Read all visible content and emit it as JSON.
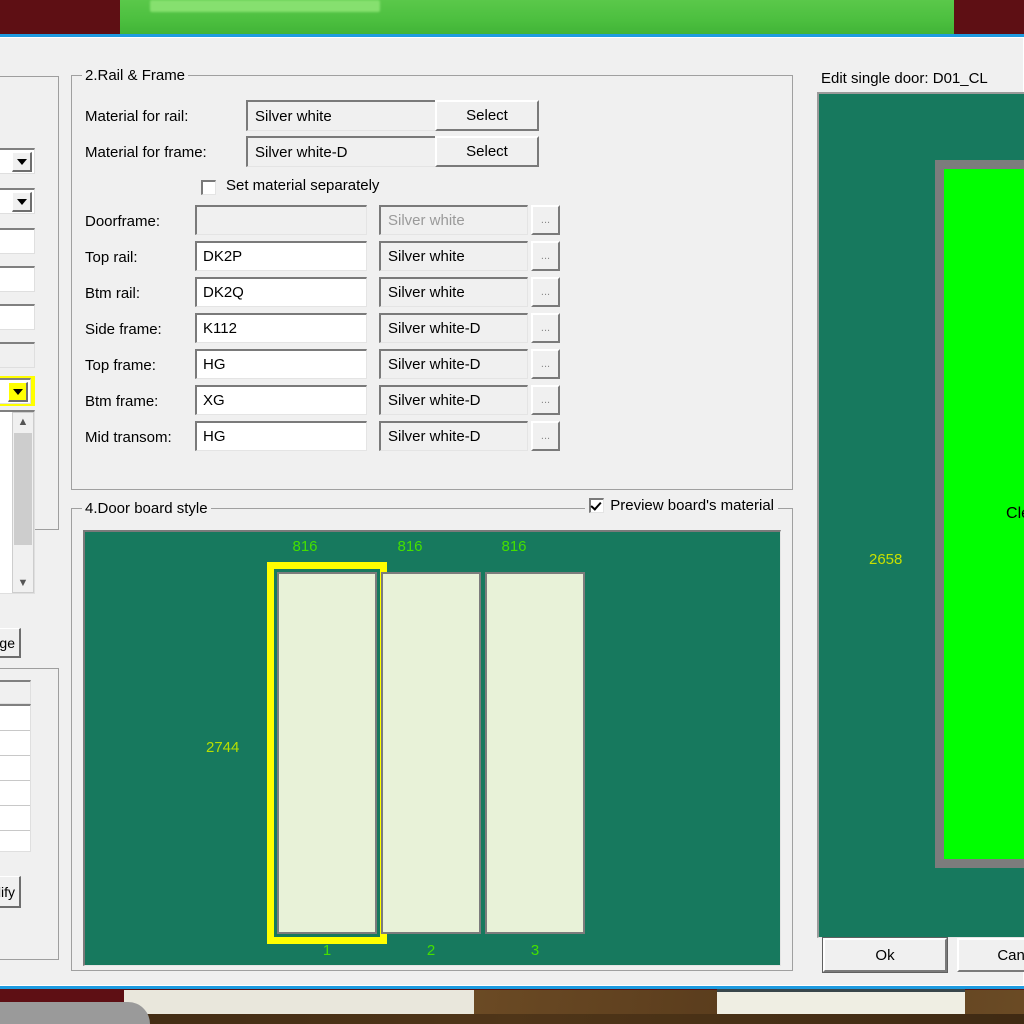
{
  "window": {
    "title_right_panel": "Edit single door:  D01_CL"
  },
  "rail_frame": {
    "group_title": "2.Rail & Frame",
    "material_rail_label": "Material for rail:",
    "material_rail_value": "Silver white",
    "material_rail_button": "Select",
    "material_frame_label": "Material for frame:",
    "material_frame_value": "Silver white-D",
    "material_frame_button": "Select",
    "set_separately_label": "Set material separately",
    "set_separately_checked": false,
    "ellipsis_button": "...",
    "rows": [
      {
        "label": "Doorframe:",
        "profile": "",
        "material": "Silver white",
        "disabled": true
      },
      {
        "label": "Top rail:",
        "profile": "DK2P",
        "material": "Silver white",
        "disabled": false
      },
      {
        "label": "Btm rail:",
        "profile": "DK2Q",
        "material": "Silver white",
        "disabled": false
      },
      {
        "label": "Side frame:",
        "profile": "K112",
        "material": "Silver white-D",
        "disabled": false
      },
      {
        "label": "Top frame:",
        "profile": "HG",
        "material": "Silver white-D",
        "disabled": false
      },
      {
        "label": "Btm frame:",
        "profile": "XG",
        "material": "Silver white-D",
        "disabled": false
      },
      {
        "label": "Mid transom:",
        "profile": "HG",
        "material": "Silver white-D",
        "disabled": false
      }
    ]
  },
  "door_board_style": {
    "group_title": "4.Door board style",
    "preview_checkbox_label": "Preview board's material",
    "preview_checkbox_checked": true,
    "height_dim": "2744",
    "boards": [
      {
        "index": "1",
        "width": "816",
        "selected": true
      },
      {
        "index": "2",
        "width": "816",
        "selected": false
      },
      {
        "index": "3",
        "width": "816",
        "selected": false
      }
    ]
  },
  "door_preview": {
    "height_dim": "2658",
    "glass_label": "Clea"
  },
  "dialog_buttons": {
    "ok": "Ok",
    "cancel": "Cance"
  },
  "left_panel": {
    "change_button": "ange",
    "modify_button": "odify"
  },
  "colors": {
    "preview_bg": "#17795e",
    "board_fill": "#e8f2d8",
    "selection_yellow": "#ffff00",
    "dim_green": "#44e000",
    "glass_green": "#00ff00",
    "dialog_face": "#f0f0f0",
    "list_selection_blue": "#0a7ad4"
  }
}
